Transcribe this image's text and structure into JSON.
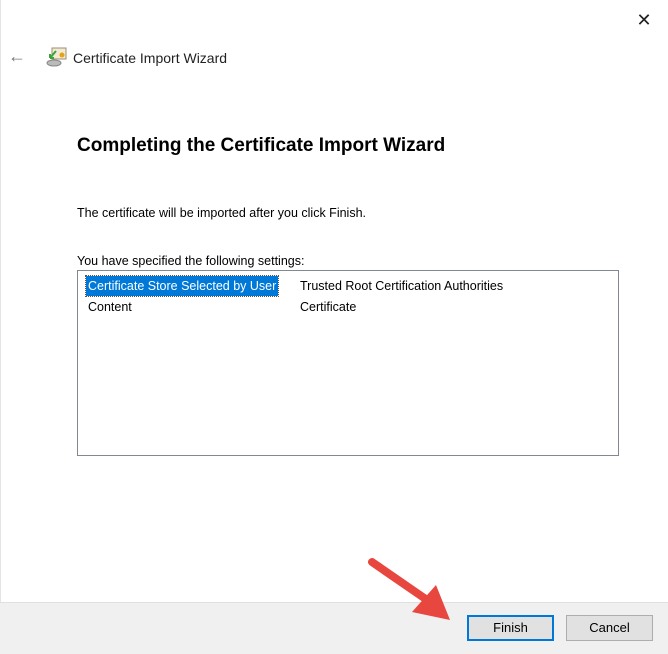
{
  "window": {
    "title": "Certificate Import Wizard",
    "close_glyph": "✕",
    "back_glyph": "←"
  },
  "heading": "Completing the Certificate Import Wizard",
  "info": "The certificate will be imported after you click Finish.",
  "settings_label": "You have specified the following settings:",
  "settings": [
    {
      "key": "Certificate Store Selected by User",
      "value": "Trusted Root Certification Authorities",
      "selected": true
    },
    {
      "key": "Content",
      "value": "Certificate",
      "selected": false
    }
  ],
  "buttons": {
    "finish": "Finish",
    "cancel": "Cancel"
  },
  "colors": {
    "accent": "#0078d7",
    "annotation_arrow": "#e8473f"
  }
}
